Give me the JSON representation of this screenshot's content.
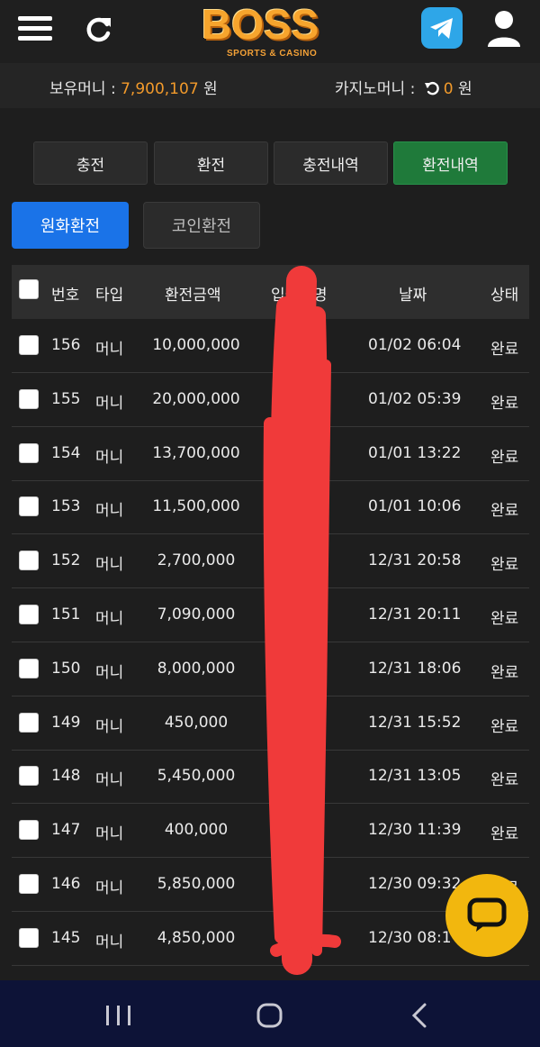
{
  "header": {
    "logo_text": "BOSS",
    "logo_subtext": "SPORTS & CASINO"
  },
  "balance": {
    "money_label": "보유머니 :",
    "money_value": "7,900,107",
    "money_unit": "원",
    "casino_label": "카지노머니 :",
    "casino_value": "0",
    "casino_unit": "원"
  },
  "tabs": [
    "충전",
    "환전",
    "충전내역",
    "환전내역"
  ],
  "subtabs": [
    "원화환전",
    "코인환전"
  ],
  "table": {
    "headers": [
      "번호",
      "타입",
      "환전금액",
      "입금자명",
      "날짜",
      "상태"
    ],
    "rows": [
      {
        "no": "156",
        "type": "머니",
        "amount": "10,000,000",
        "date": "01/02 06:04",
        "status": "완료"
      },
      {
        "no": "155",
        "type": "머니",
        "amount": "20,000,000",
        "date": "01/02 05:39",
        "status": "완료"
      },
      {
        "no": "154",
        "type": "머니",
        "amount": "13,700,000",
        "date": "01/01 13:22",
        "status": "완료"
      },
      {
        "no": "153",
        "type": "머니",
        "amount": "11,500,000",
        "date": "01/01 10:06",
        "status": "완료"
      },
      {
        "no": "152",
        "type": "머니",
        "amount": "2,700,000",
        "date": "12/31 20:58",
        "status": "완료"
      },
      {
        "no": "151",
        "type": "머니",
        "amount": "7,090,000",
        "date": "12/31 20:11",
        "status": "완료"
      },
      {
        "no": "150",
        "type": "머니",
        "amount": "8,000,000",
        "date": "12/31 18:06",
        "status": "완료"
      },
      {
        "no": "149",
        "type": "머니",
        "amount": "450,000",
        "date": "12/31 15:52",
        "status": "완료"
      },
      {
        "no": "148",
        "type": "머니",
        "amount": "5,450,000",
        "date": "12/31 13:05",
        "status": "완료"
      },
      {
        "no": "147",
        "type": "머니",
        "amount": "400,000",
        "date": "12/30 11:39",
        "status": "완료"
      },
      {
        "no": "146",
        "type": "머니",
        "amount": "5,850,000",
        "date": "12/30 09:32",
        "status": "완료"
      },
      {
        "no": "145",
        "type": "머니",
        "amount": "4,850,000",
        "date": "12/30 08:1",
        "status": ""
      }
    ]
  },
  "colors": {
    "accent_orange": "#f29a2b",
    "active_tab": "#1f7a3a",
    "active_subtab": "#1a73e8",
    "chat_button": "#f2b70e",
    "redaction": "#f03a3a"
  }
}
